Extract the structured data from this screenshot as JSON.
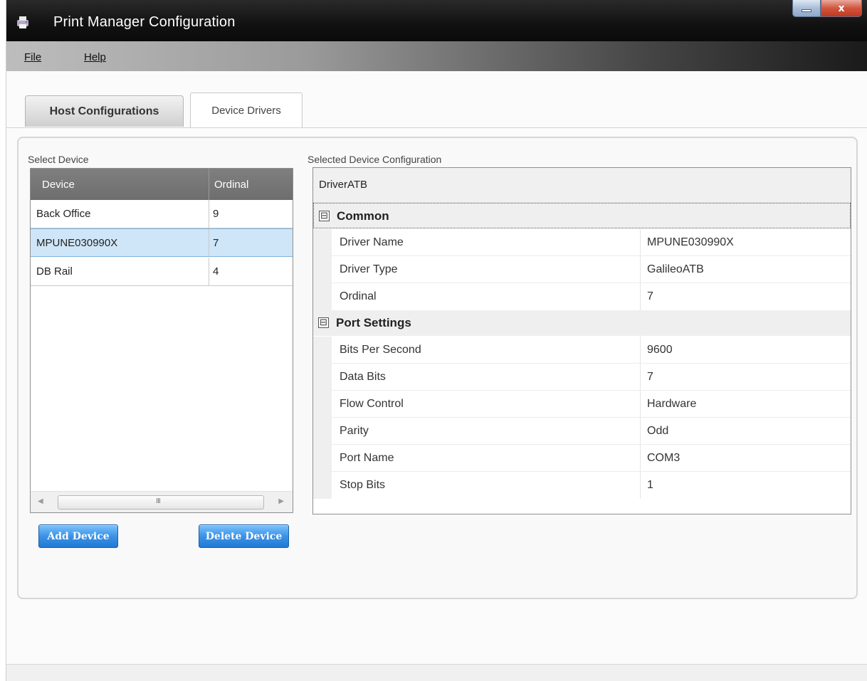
{
  "window": {
    "title": "Print Manager Configuration",
    "app_icon": "printer-icon",
    "minimize_icon": "minimize-icon",
    "close_label": "x"
  },
  "menu": {
    "file": "File",
    "help": "Help"
  },
  "tabs": [
    {
      "label": "Host Configurations",
      "active": false
    },
    {
      "label": "Device Drivers",
      "active": true
    }
  ],
  "select_device": {
    "label": "Select Device",
    "columns": [
      "Device",
      "Ordinal"
    ],
    "rows": [
      {
        "device": "Back Office",
        "ordinal": "9",
        "selected": false
      },
      {
        "device": "MPUNE030990X",
        "ordinal": "7",
        "selected": true
      },
      {
        "device": "DB Rail",
        "ordinal": "4",
        "selected": false
      }
    ],
    "scroll_left_icon": "arrow-left-icon",
    "scroll_right_icon": "arrow-right-icon",
    "scroll_grip": "III"
  },
  "buttons": {
    "add": "Add Device",
    "delete": "Delete Device"
  },
  "config": {
    "label": "Selected Device Configuration",
    "header": "DriverATB",
    "categories": [
      {
        "name": "Common",
        "toggle": "⊟",
        "properties": [
          {
            "name": "Driver Name",
            "value": "MPUNE030990X"
          },
          {
            "name": "Driver Type",
            "value": "GalileoATB"
          },
          {
            "name": "Ordinal",
            "value": "7"
          }
        ]
      },
      {
        "name": "Port Settings",
        "toggle": "⊟",
        "properties": [
          {
            "name": "Bits Per Second",
            "value": "9600"
          },
          {
            "name": "Data Bits",
            "value": "7"
          },
          {
            "name": "Flow Control",
            "value": "Hardware"
          },
          {
            "name": "Parity",
            "value": "Odd"
          },
          {
            "name": "Port Name",
            "value": "COM3"
          },
          {
            "name": "Stop Bits",
            "value": "1"
          }
        ]
      }
    ]
  },
  "colors": {
    "selection": "#cfe6f8",
    "button_blue": "#2179d4",
    "grid_header": "#6e6e6e"
  }
}
